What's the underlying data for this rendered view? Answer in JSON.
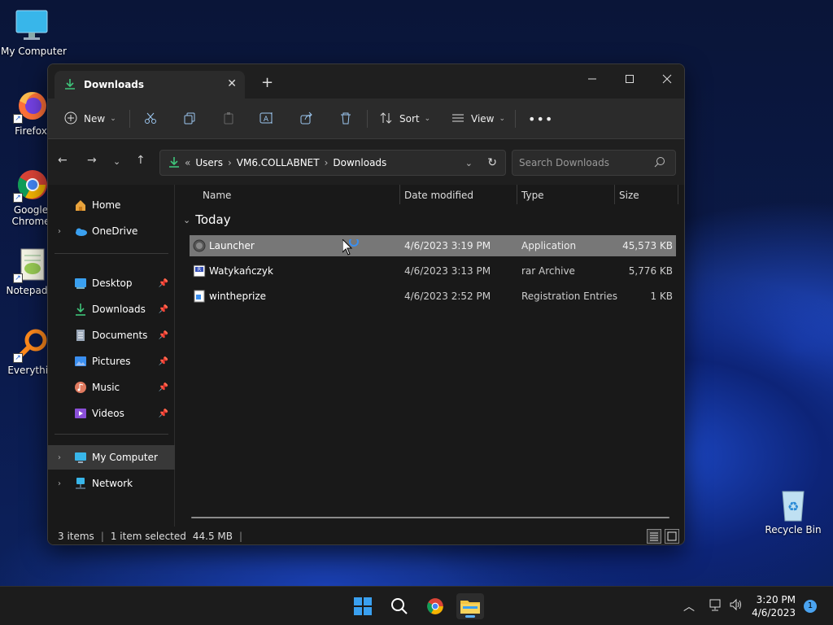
{
  "desktop": {
    "icons": [
      {
        "label": "My Computer"
      },
      {
        "label": "Firefox"
      },
      {
        "label": "Google Chrome",
        "label_line1": "Google",
        "label_line2": "Chrome"
      },
      {
        "label": "Notepad+"
      },
      {
        "label": "Everythin"
      },
      {
        "label": "Recycle Bin"
      }
    ]
  },
  "window": {
    "tab_title": "Downloads",
    "toolbar": {
      "new_label": "New",
      "sort_label": "Sort",
      "view_label": "View"
    },
    "address": {
      "crumbs": [
        "Users",
        "VM6.COLLABNET",
        "Downloads"
      ]
    },
    "search": {
      "placeholder": "Search Downloads"
    },
    "nav": {
      "items": [
        {
          "label": "Home"
        },
        {
          "label": "OneDrive"
        },
        {
          "label": "Desktop"
        },
        {
          "label": "Downloads"
        },
        {
          "label": "Documents"
        },
        {
          "label": "Pictures"
        },
        {
          "label": "Music"
        },
        {
          "label": "Videos"
        },
        {
          "label": "My Computer"
        },
        {
          "label": "Network"
        }
      ]
    },
    "columns": [
      "Name",
      "Date modified",
      "Type",
      "Size"
    ],
    "group_label": "Today",
    "files": [
      {
        "name": "Launcher",
        "date": "4/6/2023 3:19 PM",
        "type": "Application",
        "size": "45,573 KB"
      },
      {
        "name": "Watykańczyk",
        "date": "4/6/2023 3:13 PM",
        "type": "rar Archive",
        "size": "5,776 KB"
      },
      {
        "name": "wintheprize",
        "date": "4/6/2023 2:52 PM",
        "type": "Registration Entries",
        "size": "1 KB"
      }
    ],
    "status": {
      "count": "3 items",
      "selection": "1 item selected",
      "selection_size": "44.5 MB"
    }
  },
  "taskbar": {
    "time": "3:20 PM",
    "date": "4/6/2023",
    "notifications": "1"
  }
}
